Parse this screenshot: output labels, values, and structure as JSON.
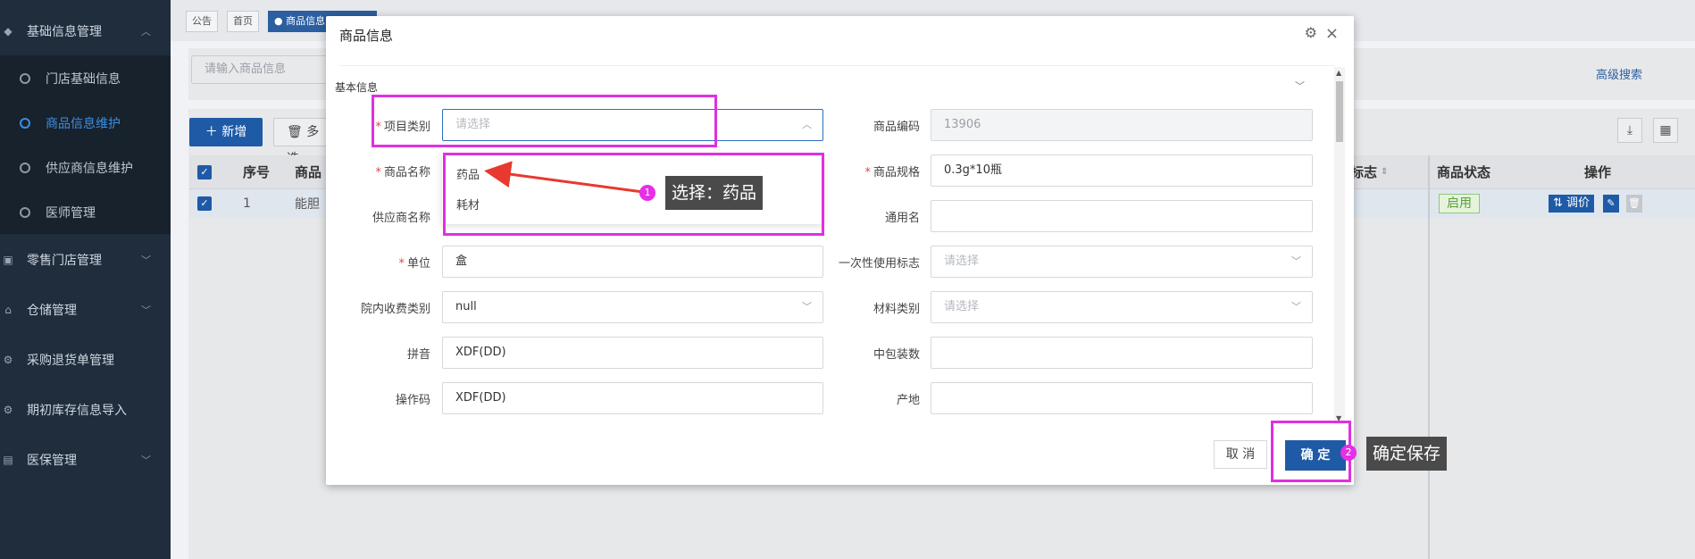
{
  "sidebar": {
    "groups": [
      {
        "label": "基础信息管理",
        "icon": "layers-icon"
      },
      {
        "label": "零售门店管理",
        "icon": "store-icon"
      },
      {
        "label": "仓储管理",
        "icon": "warehouse-icon"
      },
      {
        "label": "采购退货单管理",
        "icon": "gear-icon"
      },
      {
        "label": "期初库存信息导入",
        "icon": "gear-icon"
      },
      {
        "label": "医保管理",
        "icon": "card-icon"
      }
    ],
    "items": [
      {
        "label": "门店基础信息"
      },
      {
        "label": "商品信息维护"
      },
      {
        "label": "供应商信息维护"
      },
      {
        "label": "医师管理"
      }
    ]
  },
  "tabs": [
    {
      "label": "公告"
    },
    {
      "label": "首页"
    },
    {
      "label": "● 商品信息"
    }
  ],
  "toolbar": {
    "search_placeholder": "请输入商品信息",
    "advanced_search": "高级搜索",
    "new_label": "＋ 新增",
    "multi_label": "多选"
  },
  "table": {
    "headers": {
      "seq": "序号",
      "name": "商品",
      "flag": "标志",
      "status": "商品状态",
      "ops": "操作"
    },
    "row": {
      "seq": "1",
      "name": "能胆",
      "status": "启用",
      "price_btn": "调价"
    }
  },
  "modal": {
    "title": "商品信息",
    "section": "基本信息",
    "fields": {
      "category_label": "项目类别",
      "category_placeholder": "请选择",
      "code_label": "商品编码",
      "code_value": "13906",
      "name_label": "商品名称",
      "spec_label": "商品规格",
      "spec_value": "0.3g*10瓶",
      "supplier_label": "供应商名称",
      "common_label": "通用名",
      "unit_label": "单位",
      "unit_value": "盒",
      "onetime_label": "一次性使用标志",
      "onetime_placeholder": "请选择",
      "fee_label": "院内收费类别",
      "fee_value": "null",
      "material_label": "材料类别",
      "material_placeholder": "请选择",
      "pinyin_label": "拼音",
      "pinyin_value": "XDF(DD)",
      "midpack_label": "中包装数",
      "opcode_label": "操作码",
      "opcode_value": "XDF(DD)",
      "origin_label": "产地"
    },
    "dropdown_options": [
      "药品",
      "耗材"
    ],
    "cancel_label": "取 消",
    "ok_label": "确 定"
  },
  "annotations": [
    {
      "badge": "1",
      "text": "选择：药品"
    },
    {
      "badge": "2",
      "text": "确定保存"
    }
  ]
}
